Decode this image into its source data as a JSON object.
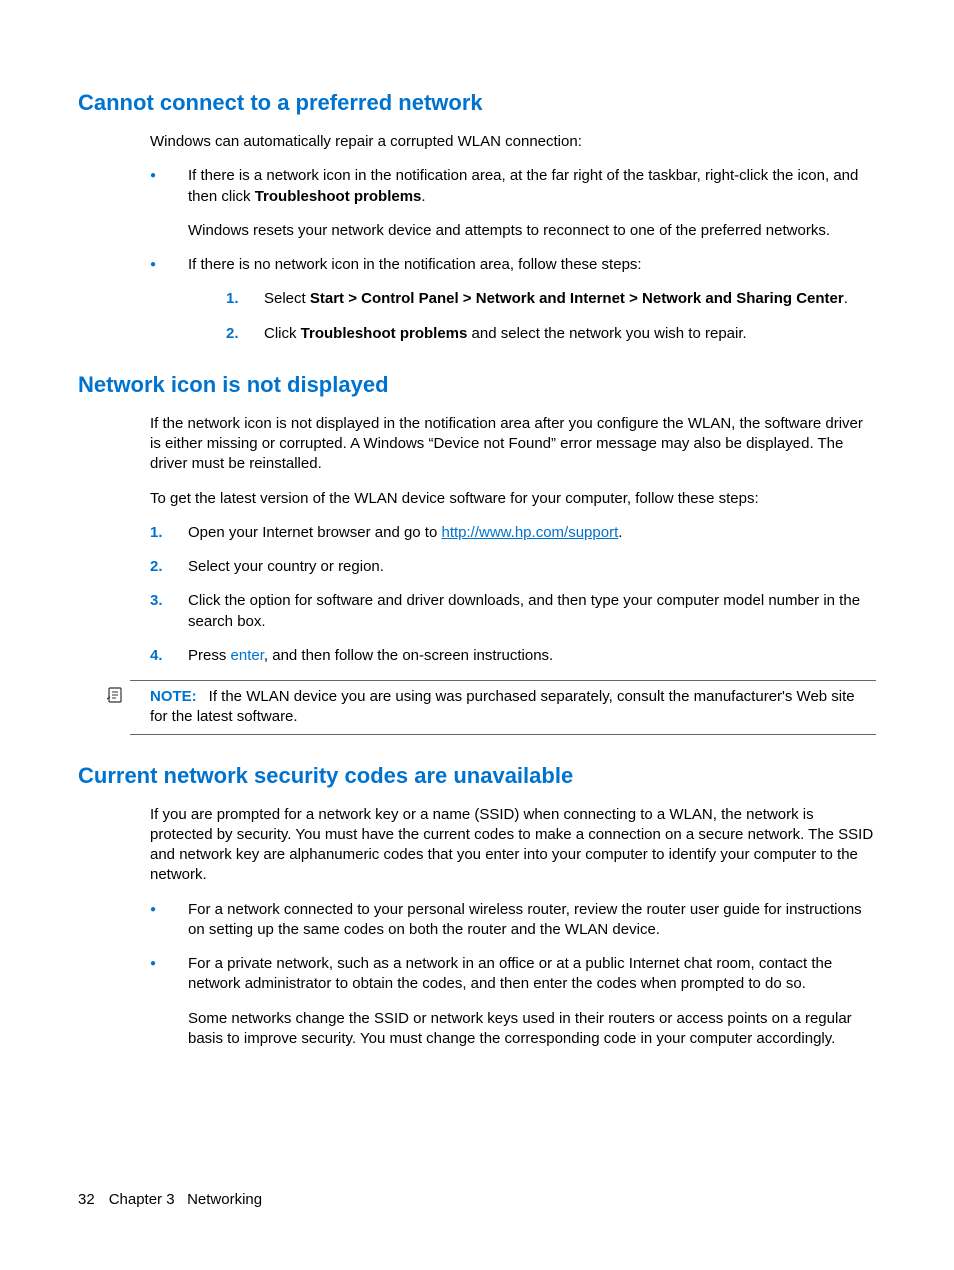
{
  "section1": {
    "heading": "Cannot connect to a preferred network",
    "intro": "Windows can automatically repair a corrupted WLAN connection:",
    "bullet1_a": "If there is a network icon in the notification area, at the far right of the taskbar, right-click the icon, and then click ",
    "bullet1_bold": "Troubleshoot problems",
    "bullet1_b": ".",
    "bullet1_sub": "Windows resets your network device and attempts to reconnect to one of the preferred networks.",
    "bullet2": "If there is no network icon in the notification area, follow these steps:",
    "step1_a": "Select ",
    "step1_bold": "Start > Control Panel > Network and Internet > Network and Sharing Center",
    "step1_b": ".",
    "step2_a": "Click ",
    "step2_bold": "Troubleshoot problems",
    "step2_b": " and select the network you wish to repair."
  },
  "section2": {
    "heading": "Network icon is not displayed",
    "p1": "If the network icon is not displayed in the notification area after you configure the WLAN, the software driver is either missing or corrupted. A Windows “Device not Found” error message may also be displayed. The driver must be reinstalled.",
    "p2": "To get the latest version of the WLAN device software for your computer, follow these steps:",
    "step1_a": "Open your Internet browser and go to ",
    "step1_link": "http://www.hp.com/support",
    "step1_b": ".",
    "step2": "Select your country or region.",
    "step3": "Click the option for software and driver downloads, and then type your computer model number in the search box.",
    "step4_a": "Press ",
    "step4_key": "enter",
    "step4_b": ", and then follow the on-screen instructions.",
    "note_label": "NOTE:",
    "note_body": "If the WLAN device you are using was purchased separately, consult the manufacturer's Web site for the latest software."
  },
  "section3": {
    "heading": "Current network security codes are unavailable",
    "p1": "If you are prompted for a network key or a name (SSID) when connecting to a WLAN, the network is protected by security. You must have the current codes to make a connection on a secure network. The SSID and network key are alphanumeric codes that you enter into your computer to identify your computer to the network.",
    "bullet1": "For a network connected to your personal wireless router, review the router user guide for instructions on setting up the same codes on both the router and the WLAN device.",
    "bullet2": "For a private network, such as a network in an office or at a public Internet chat room, contact the network administrator to obtain the codes, and then enter the codes when prompted to do so.",
    "bullet2_sub": "Some networks change the SSID or network keys used in their routers or access points on a regular basis to improve security. You must change the corresponding code in your computer accordingly."
  },
  "footer": {
    "page_number": "32",
    "chapter": "Chapter 3   Networking"
  }
}
